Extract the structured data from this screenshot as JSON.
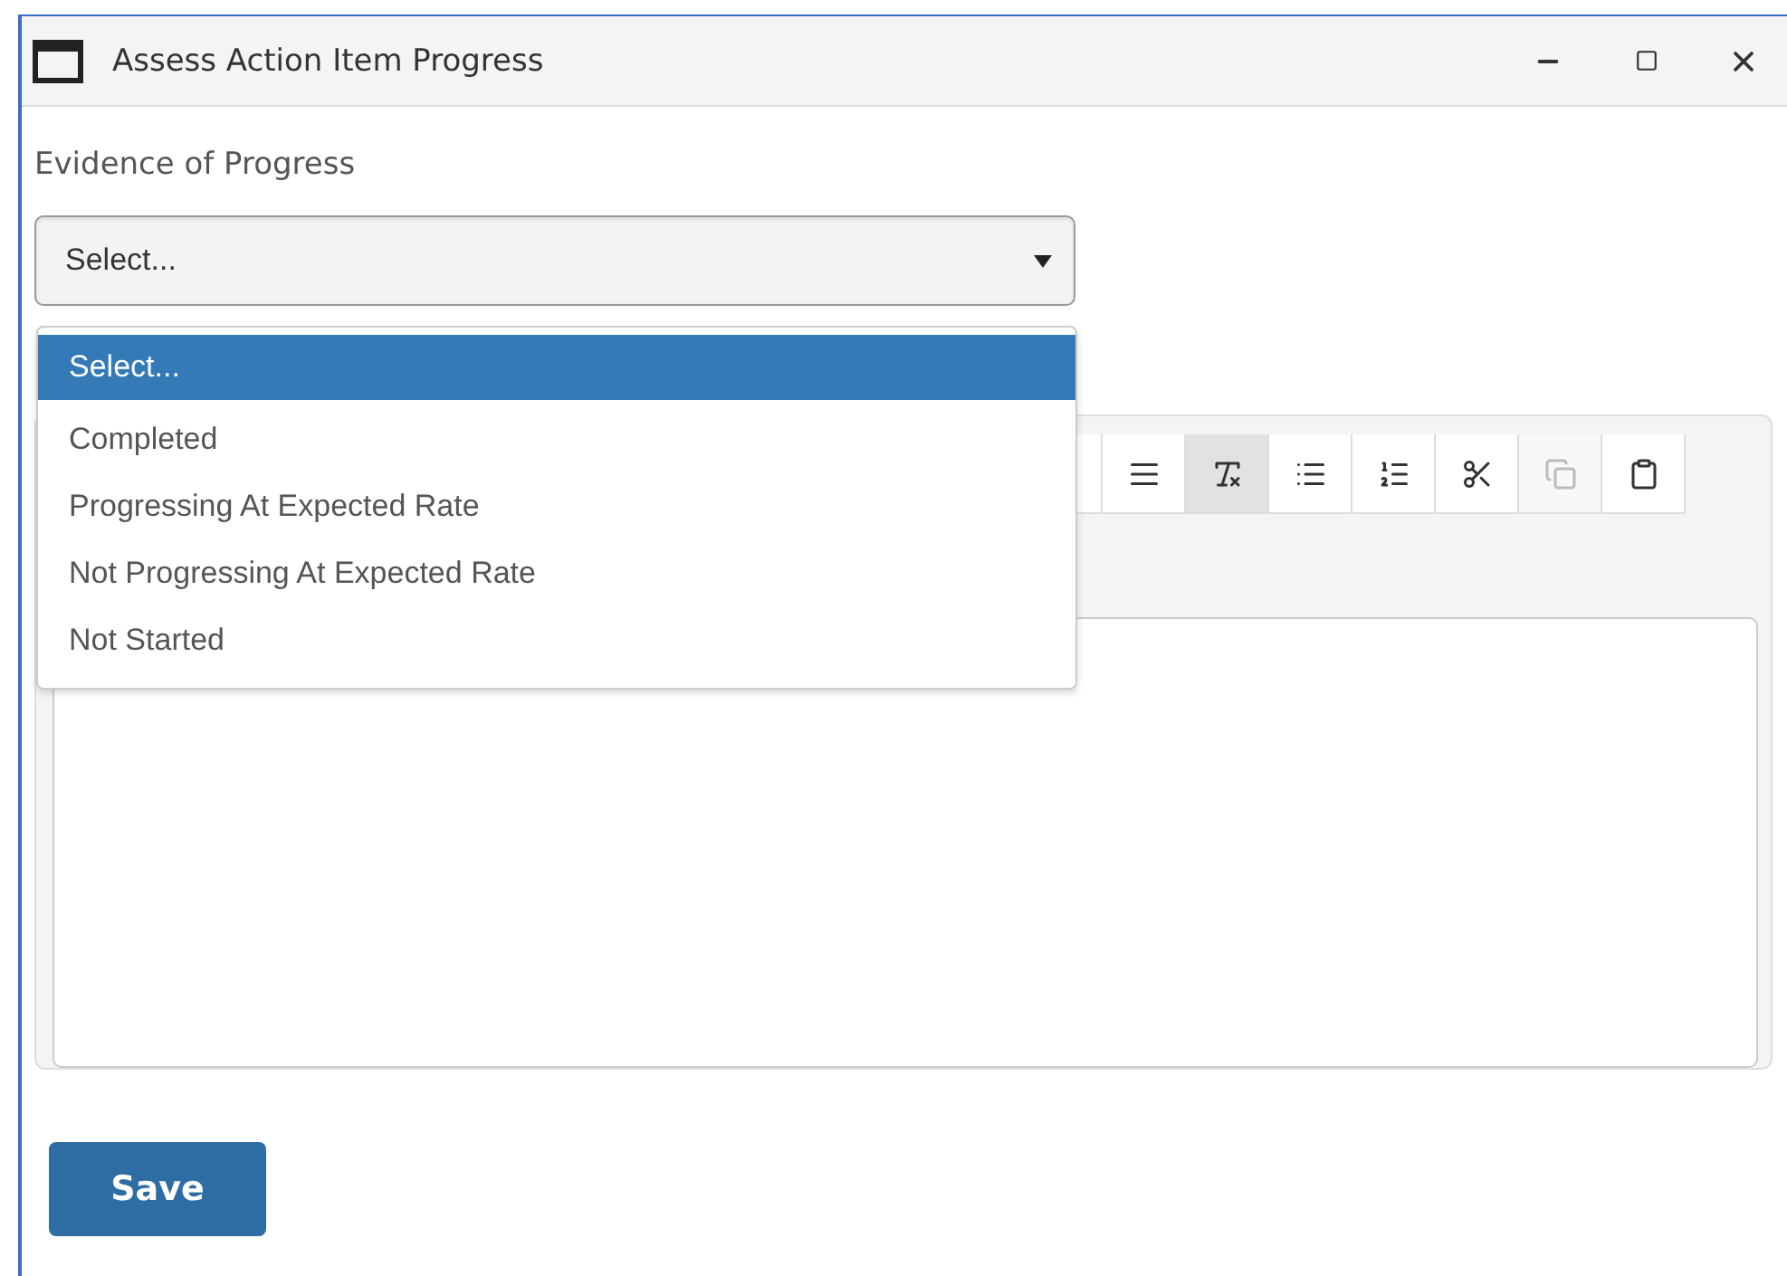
{
  "window": {
    "title": "Assess Action Item Progress"
  },
  "field": {
    "label": "Evidence of Progress",
    "value": "Select...",
    "expanded": true,
    "options": [
      {
        "label": "Select...",
        "selected": true
      },
      {
        "label": "Completed",
        "selected": false
      },
      {
        "label": "Progressing At Expected Rate",
        "selected": false
      },
      {
        "label": "Not Progressing At Expected Rate",
        "selected": false
      },
      {
        "label": "Not Started",
        "selected": false
      }
    ]
  },
  "toolbar": [
    {
      "kind": "justify",
      "active": false,
      "disabled": false
    },
    {
      "kind": "clear-format",
      "active": true,
      "disabled": false
    },
    {
      "kind": "bullets",
      "active": false,
      "disabled": false
    },
    {
      "kind": "numbered",
      "active": false,
      "disabled": false
    },
    {
      "kind": "cut",
      "active": false,
      "disabled": false
    },
    {
      "kind": "copy",
      "active": false,
      "disabled": true
    },
    {
      "kind": "paste",
      "active": false,
      "disabled": false
    }
  ],
  "save_button": "Save"
}
